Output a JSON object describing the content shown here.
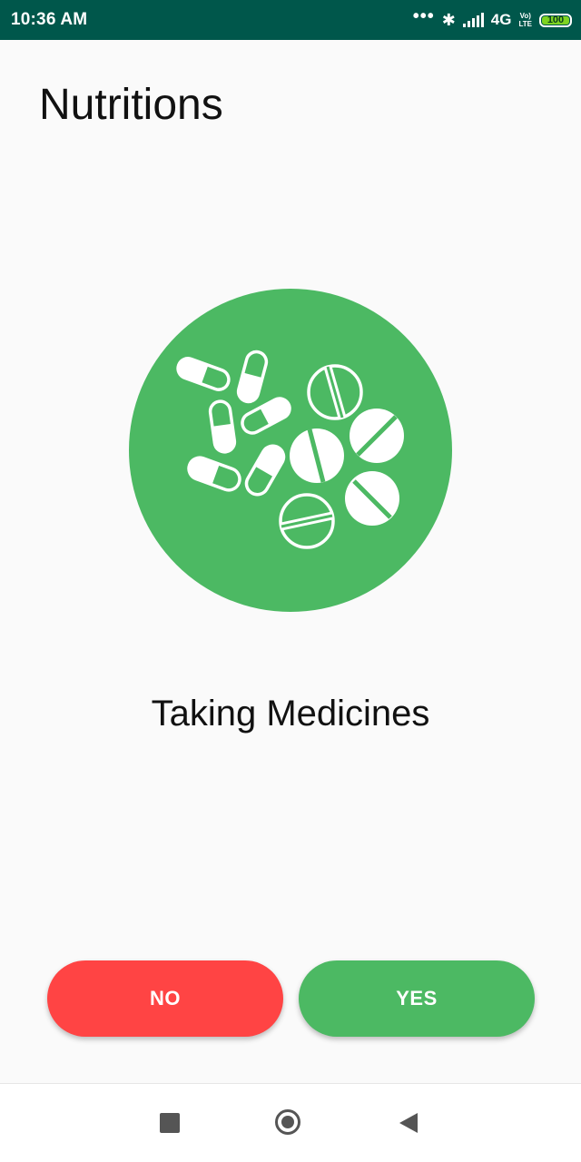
{
  "status_bar": {
    "time": "10:36 AM",
    "network": "4G",
    "volte_top": "Vo)",
    "volte_bottom": "LTE",
    "battery": "100"
  },
  "page": {
    "title": "Nutritions",
    "caption": "Taking Medicines"
  },
  "actions": {
    "no_label": "NO",
    "yes_label": "YES"
  },
  "colors": {
    "status_bar": "#00574b",
    "accent_green": "#4cb963",
    "no_red": "#ff4444",
    "background": "#fafafa"
  },
  "icons": {
    "illustration": "pills-icon",
    "nav_recents": "square-icon",
    "nav_home": "circle-icon",
    "nav_back": "triangle-back-icon"
  }
}
